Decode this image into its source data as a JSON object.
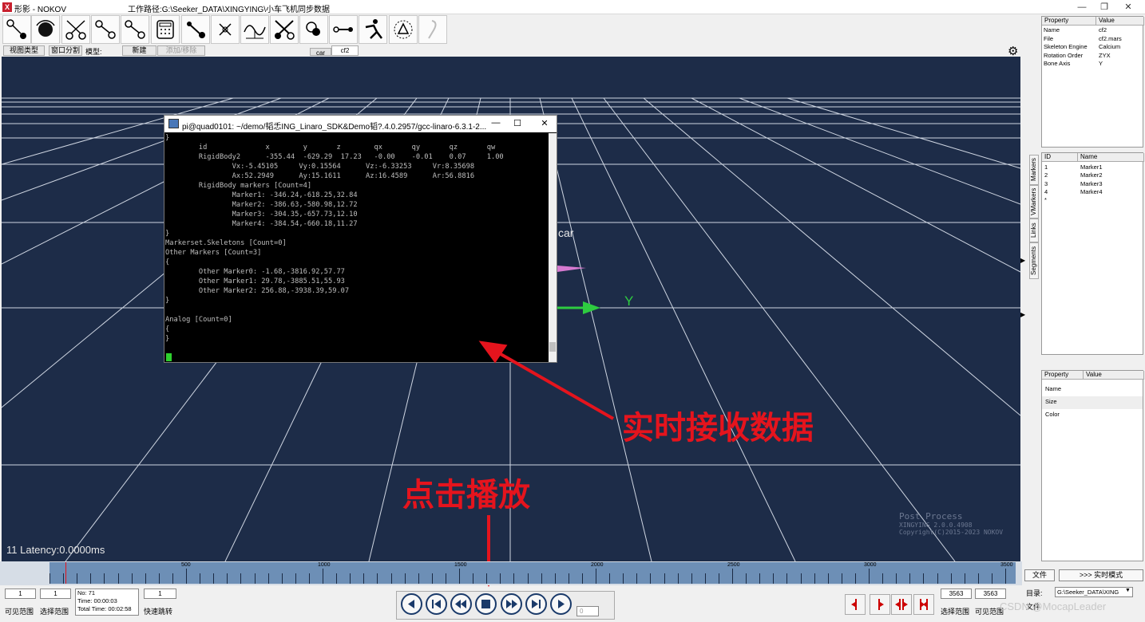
{
  "window": {
    "app_title": "形影 - NOKOV",
    "logo": "X",
    "work_path": "工作路径:G:\\Seeker_DATA\\XINGYING\\小车飞机同步数据",
    "min": "—",
    "max": "❐",
    "close": "✕"
  },
  "toolbar": {
    "view_type": "视图类型",
    "window_split": "窗口分割",
    "model_label": "模型:",
    "new_label": "新建",
    "add_remove": "添加/移除",
    "tabs": [
      "car",
      "cf2"
    ]
  },
  "viewport": {
    "latency": "11 Latency:0.0000ms",
    "car_label": "car",
    "y_axis_label": "Y",
    "post_process": "Post Process",
    "version": "XINGYING 2.0.0.4908",
    "copyright": "Copyright(C)2015-2023 NOKOV"
  },
  "terminal": {
    "title": "pi@quad0101: ~/demo/韬忎ING_Linaro_SDK&Demo韬?.4.0.2957/gcc-linaro-6.3.1-2...",
    "lines": [
      "}",
      "        id              x        y       z        qx       qy       qz       qw",
      "        RigidBody2      -355.44  -629.29  17.23   -0.00    -0.01    0.07     1.00",
      "                Vx:-5.45105     Vy:0.15564      Vz:-6.33253     Vr:8.35698",
      "                Ax:52.2949      Ay:15.1611      Az:16.4589      Ar:56.8816",
      "        RigidBody markers [Count=4]",
      "                Marker1: -346.24,-618.25,32.84",
      "                Marker2: -386.63,-580.98,12.72",
      "                Marker3: -304.35,-657.73,12.10",
      "                Marker4: -384.54,-660.18,11.27",
      "}",
      "Markerset.Skeletons [Count=0]",
      "Other Markers [Count=3]",
      "{",
      "        Other Marker0: -1.68,-3816.92,57.77",
      "        Other Marker1: 29.78,-3885.51,55.93",
      "        Other Marker2: 256.88,-3938.39,59.07",
      "}",
      "",
      "Analog [Count=0]",
      "{",
      "}"
    ]
  },
  "annotations": {
    "realtime": "实时接收数据",
    "click_play": "点击播放"
  },
  "right_panel": {
    "prop_header": [
      "Property",
      "Value"
    ],
    "props": [
      [
        "Name",
        "cf2"
      ],
      [
        "File",
        "cf2.mars"
      ],
      [
        "Skeleton Engine",
        "Calcium"
      ],
      [
        "Rotation Order",
        "ZYX"
      ],
      [
        "Bone Axis",
        "Y"
      ]
    ],
    "marker_header": [
      "ID",
      "Name"
    ],
    "markers": [
      [
        "1",
        "Marker1"
      ],
      [
        "2",
        "Marker2"
      ],
      [
        "3",
        "Marker3"
      ],
      [
        "4",
        "Marker4"
      ],
      [
        "*",
        ""
      ]
    ],
    "vtabs": [
      "Markers",
      "VMarkers",
      "Links",
      "Segments"
    ],
    "prop2_header": [
      "Property",
      "Value"
    ],
    "props2": [
      "Name",
      "Size",
      "Color"
    ]
  },
  "timeline": {
    "ticks": [
      "500",
      "1000",
      "1500",
      "2000",
      "2500",
      "3000",
      "3500"
    ]
  },
  "bottom": {
    "visible_start": "1",
    "select_start": "1",
    "frame_no": "No: 71",
    "time": "Time: 00:00:03",
    "total_time": "Total Time: 00:02:58",
    "jump_value": "1",
    "visible_range": "可见范围",
    "select_range": "选择范围",
    "quick_jump": "快速跳转",
    "speed_value": "0",
    "select_end": "3563",
    "visible_end": "3563",
    "select_range_r": "选择范围",
    "visible_range_r": "可见范围",
    "file_btn": "文件",
    "realtime_mode": ">>> 实时模式",
    "dir_label": "目录:",
    "dir_value": "G:\\Seeker_DATA\\XING",
    "file_label": "文件",
    "watermark": "CSDN @MocapLeader"
  }
}
